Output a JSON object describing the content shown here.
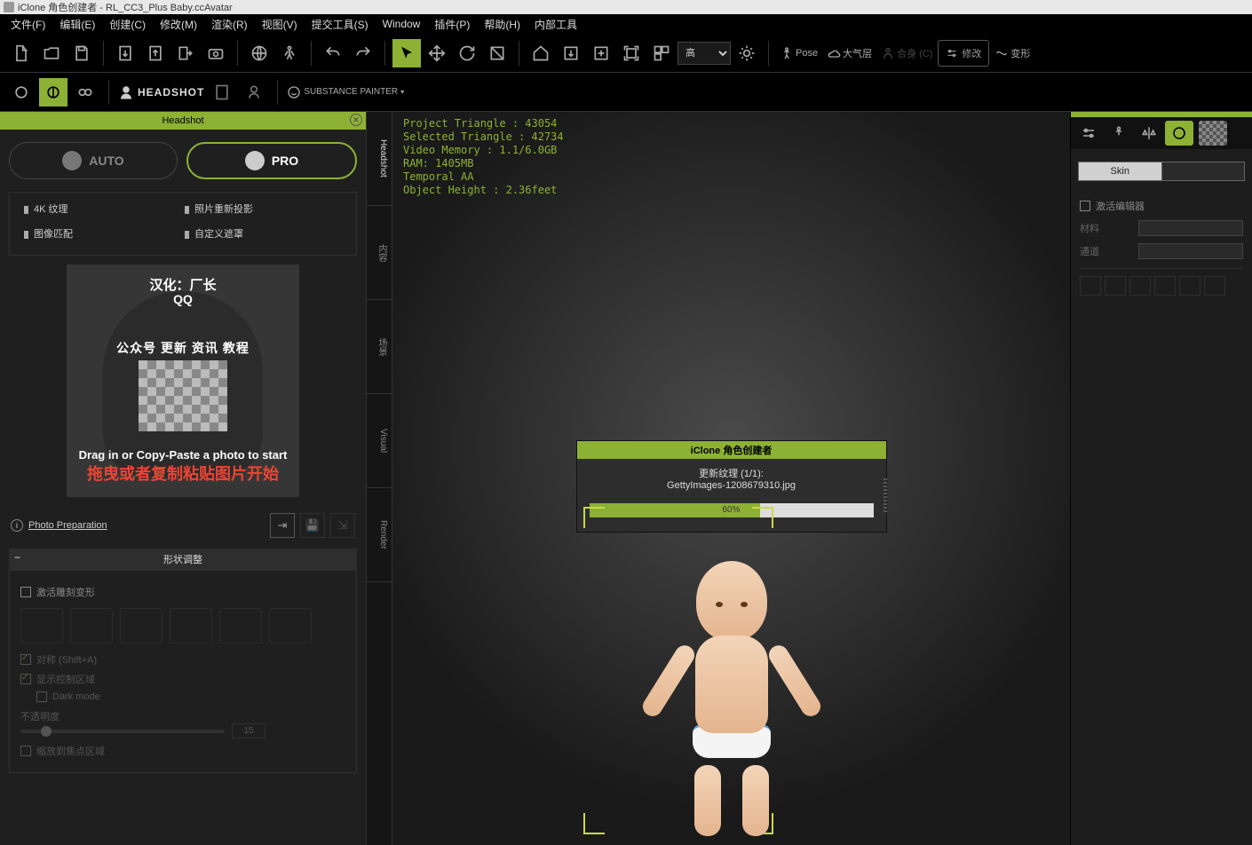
{
  "app": {
    "title": "iClone 角色创建者 - RL_CC3_Plus Baby.ccAvatar"
  },
  "menu": {
    "file": "文件(F)",
    "edit": "编辑(E)",
    "create": "创建(C)",
    "modify": "修改(M)",
    "render": "渲染(R)",
    "view": "视图(V)",
    "submit": "提交工具(S)",
    "window": "Window",
    "plugins": "插件(P)",
    "help": "帮助(H)",
    "internal": "内部工具"
  },
  "toolbar": {
    "quality": "高",
    "pose": "Pose",
    "atmos": "大气层",
    "fit": "合身 (C)",
    "modify": "修改",
    "deform": "变形"
  },
  "pluginbar": {
    "headshot": "HEADSHOT",
    "substance": "SUBSTANCE PAINTER"
  },
  "headshot": {
    "title": "Headshot",
    "auto": "AUTO",
    "pro": "PRO",
    "opt1": "4K 纹理",
    "opt2": "照片重新投影",
    "opt3": "图像匹配",
    "opt4": "自定义遮罩",
    "drop_zh1": "汉化：厂长",
    "drop_qq": "QQ",
    "drop_zh2": "公众号 更新 资讯 教程",
    "drop_en": "Drag in or Copy-Paste a photo to start",
    "drop_zh3": "拖曳或者复制粘贴图片开始",
    "photo_prep": "Photo Preparation",
    "shape_header": "形状调整",
    "activate_sculpt": "激活雕刻变形",
    "symmetry": "对称 (Shift+A)",
    "show_control": "显示控制区域",
    "dark_mode": "Dark mode",
    "opacity": "不透明度",
    "opacity_val": "15",
    "zoom_focus": "缩放到焦点区域"
  },
  "side_tabs": {
    "t1": "Headshot",
    "t2": "内容",
    "t3": "场景",
    "t4": "Visual",
    "t5": "Render"
  },
  "viewport": {
    "stats": "Project Triangle : 43054\nSelected Triangle : 42734\nVideo Memory : 1.1/6.0GB\nRAM: 1405MB\nTemporal AA\nObject Height : 2.36feet"
  },
  "progress": {
    "title": "iClone 角色创建者",
    "line1": "更新纹理 (1/1):",
    "line2": "GettyImages-1208679310.jpg",
    "percent": "60%"
  },
  "right": {
    "skin": "Skin",
    "activate_editor": "激活编辑器",
    "material": "材料",
    "channel": "通道"
  }
}
